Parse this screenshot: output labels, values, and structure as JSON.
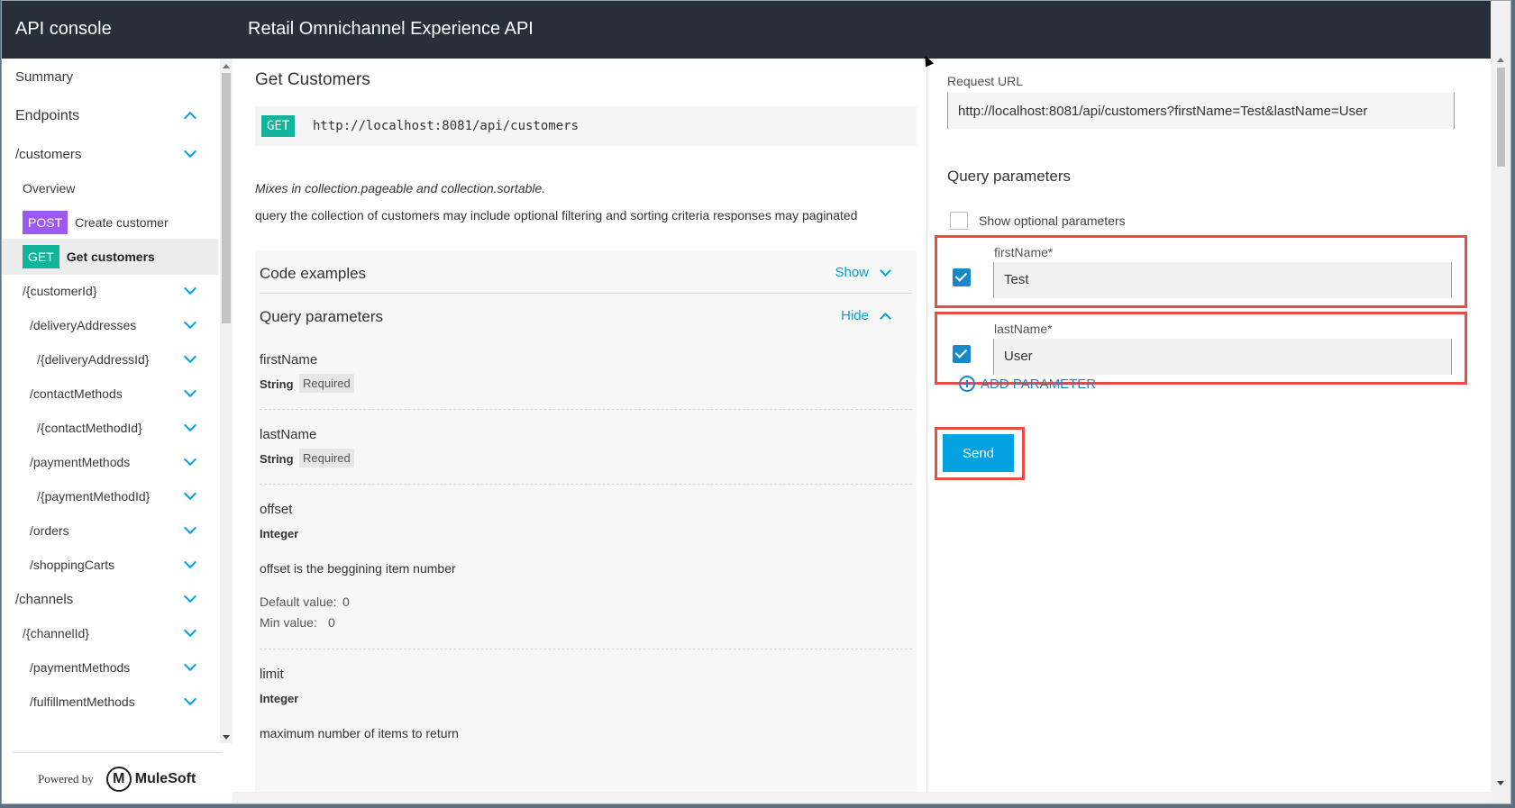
{
  "header": {
    "app_title": "API console",
    "api_title": "Retail Omnichannel Experience API"
  },
  "sidebar": {
    "items": [
      {
        "label": "Summary"
      },
      {
        "label": "Endpoints"
      },
      {
        "label": "/customers"
      },
      {
        "label": "Overview"
      },
      {
        "label": "Create customer",
        "method": "POST"
      },
      {
        "label": "Get customers",
        "method": "GET"
      },
      {
        "label": "/{customerId}"
      },
      {
        "label": "/deliveryAddresses"
      },
      {
        "label": "/{deliveryAddressId}"
      },
      {
        "label": "/contactMethods"
      },
      {
        "label": "/{contactMethodId}"
      },
      {
        "label": "/paymentMethods"
      },
      {
        "label": "/{paymentMethodId}"
      },
      {
        "label": "/orders"
      },
      {
        "label": "/shoppingCarts"
      },
      {
        "label": "/channels"
      },
      {
        "label": "/{channelId}"
      },
      {
        "label": "/paymentMethods"
      },
      {
        "label": "/fulfillmentMethods"
      }
    ],
    "powered_by": "Powered by",
    "brand": "MuleSoft",
    "brand_letter": "M"
  },
  "main": {
    "title": "Get Customers",
    "method": "GET",
    "url": "http://localhost:8081/api/customers",
    "description_italic": "Mixes in collection.pageable and collection.sortable.",
    "description": "query the collection of customers may include optional filtering and sorting criteria responses may paginated",
    "code_examples": {
      "title": "Code examples",
      "toggle": "Show"
    },
    "query_params": {
      "title": "Query parameters",
      "toggle": "Hide"
    },
    "params": [
      {
        "name": "firstName",
        "type": "String",
        "required": "Required"
      },
      {
        "name": "lastName",
        "type": "String",
        "required": "Required"
      },
      {
        "name": "offset",
        "type": "Integer",
        "description": "offset is the beggining item number",
        "default_label": "Default value:",
        "default_value": "0",
        "min_label": "Min value:",
        "min_value": "0"
      },
      {
        "name": "limit",
        "type": "Integer",
        "description": "maximum number of items to return"
      }
    ]
  },
  "request": {
    "url_label": "Request URL",
    "url": "http://localhost:8081/api/customers?firstName=Test&lastName=User",
    "query_title": "Query parameters",
    "show_optional": "Show optional parameters",
    "params": [
      {
        "name": "firstName*",
        "value": "Test",
        "checked": true
      },
      {
        "name": "lastName*",
        "value": "User",
        "checked": true
      }
    ],
    "add_parameter": "ADD PARAMETER",
    "send": "Send"
  },
  "colors": {
    "header_bg": "#27303a",
    "accent": "#00a2df",
    "get": "#13b29a",
    "post": "#9b59f0",
    "highlight": "#ec4a43"
  }
}
